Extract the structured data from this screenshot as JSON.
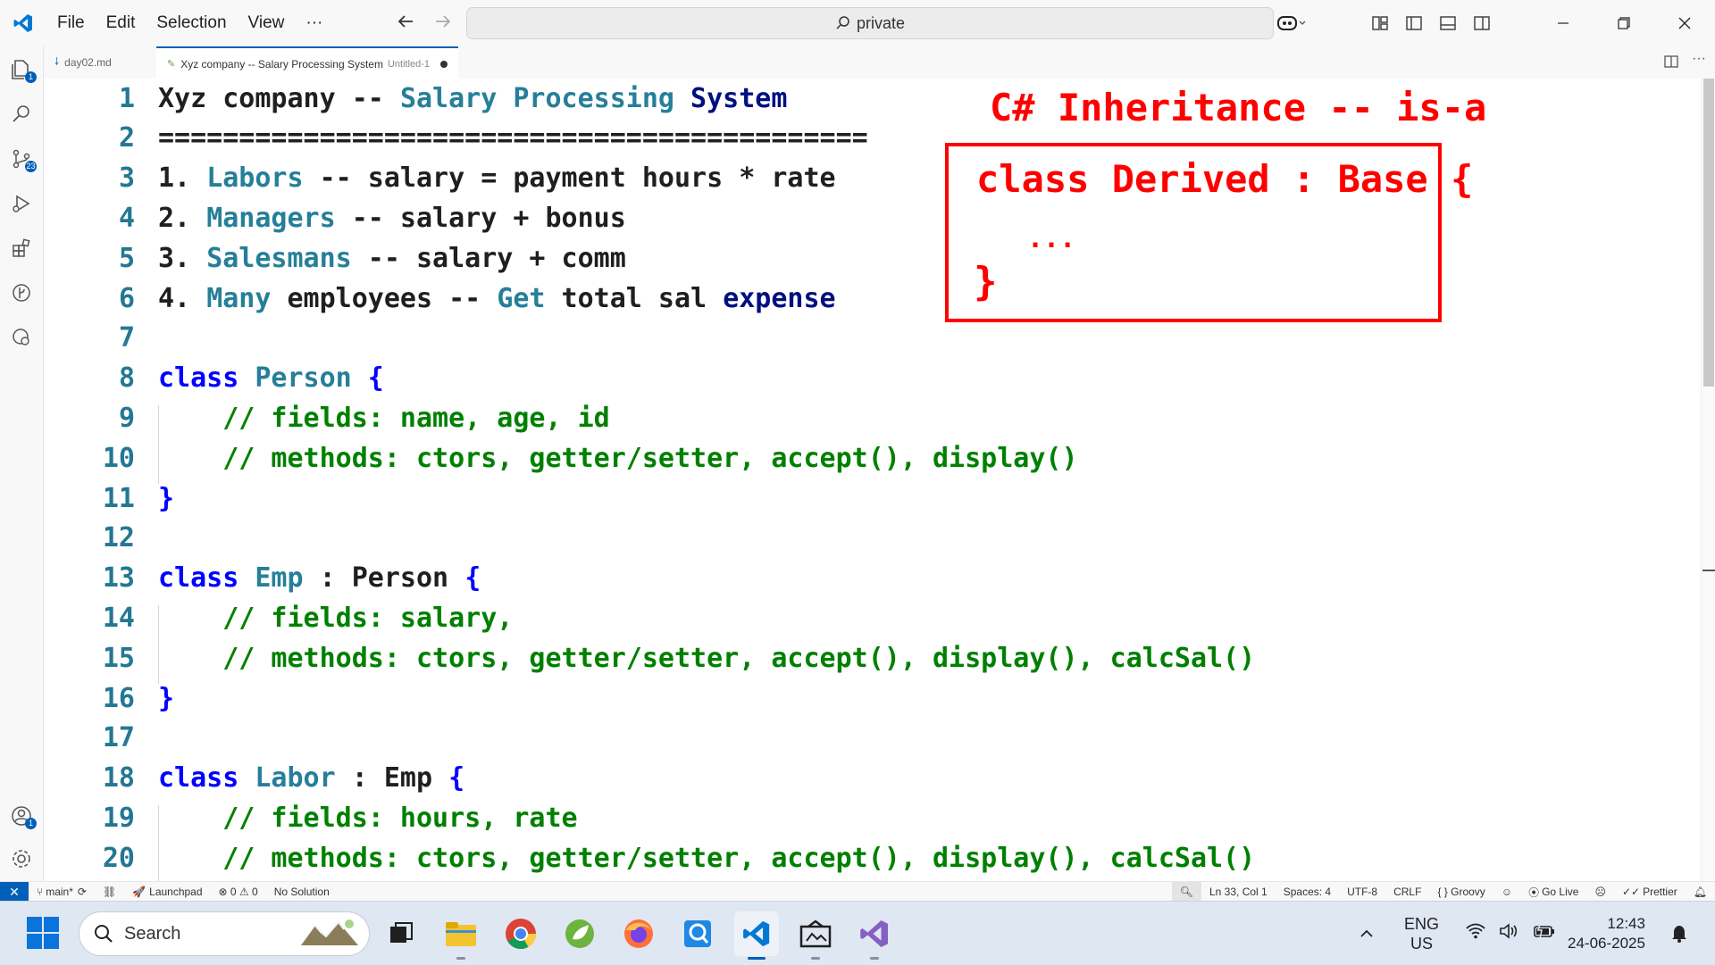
{
  "menubar": {
    "items": [
      "File",
      "Edit",
      "Selection",
      "View",
      "···"
    ]
  },
  "command_center": {
    "text": "private"
  },
  "tabs": [
    {
      "label": "day02.md",
      "active": false
    },
    {
      "label": "Xyz company -- Salary Processing System",
      "sublabel": "Untitled-1",
      "active": true,
      "modified": true
    }
  ],
  "activity_badges": {
    "explorer": "1",
    "scm": "23",
    "accounts": "1"
  },
  "editor": {
    "lines": [
      {
        "n": "1",
        "tokens": [
          [
            "Xyz ",
            "txt"
          ],
          [
            "company ",
            "txt"
          ],
          [
            "-- ",
            "txt"
          ],
          [
            "Salary Processing ",
            "type"
          ],
          [
            "System",
            "navy"
          ]
        ]
      },
      {
        "n": "2",
        "tokens": [
          [
            "============================================",
            "txt"
          ]
        ]
      },
      {
        "n": "3",
        "tokens": [
          [
            "1. ",
            "txt"
          ],
          [
            "Labors",
            "type"
          ],
          [
            " -- salary = payment hours * rate",
            "txt"
          ]
        ]
      },
      {
        "n": "4",
        "tokens": [
          [
            "2. ",
            "txt"
          ],
          [
            "Managers",
            "type"
          ],
          [
            " -- salary + bonus",
            "txt"
          ]
        ]
      },
      {
        "n": "5",
        "tokens": [
          [
            "3. ",
            "txt"
          ],
          [
            "Salesmans",
            "type"
          ],
          [
            " -- salary + comm",
            "txt"
          ]
        ]
      },
      {
        "n": "6",
        "tokens": [
          [
            "4. ",
            "txt"
          ],
          [
            "Many",
            "type"
          ],
          [
            " employees -- ",
            "txt"
          ],
          [
            "Get",
            "type"
          ],
          [
            " total sal ",
            "txt"
          ],
          [
            "expense",
            "navy"
          ]
        ]
      },
      {
        "n": "7",
        "tokens": []
      },
      {
        "n": "8",
        "tokens": [
          [
            "class ",
            "kw"
          ],
          [
            "Person",
            "type"
          ],
          [
            " {",
            "kw"
          ]
        ]
      },
      {
        "n": "9",
        "tokens": [
          [
            "    // fields: name, age, id",
            "cm"
          ]
        ]
      },
      {
        "n": "10",
        "tokens": [
          [
            "    // methods: ctors, getter/setter, accept(), display()",
            "cm"
          ]
        ]
      },
      {
        "n": "11",
        "tokens": [
          [
            "}",
            "kw"
          ]
        ]
      },
      {
        "n": "12",
        "tokens": []
      },
      {
        "n": "13",
        "tokens": [
          [
            "class ",
            "kw"
          ],
          [
            "Emp",
            "type"
          ],
          [
            " : Person ",
            "txt"
          ],
          [
            "{",
            "kw"
          ]
        ]
      },
      {
        "n": "14",
        "tokens": [
          [
            "    // fields: salary,",
            "cm"
          ]
        ]
      },
      {
        "n": "15",
        "tokens": [
          [
            "    // methods: ctors, getter/setter, accept(), display(), calcSal()",
            "cm"
          ]
        ]
      },
      {
        "n": "16",
        "tokens": [
          [
            "}",
            "kw"
          ]
        ]
      },
      {
        "n": "17",
        "tokens": []
      },
      {
        "n": "18",
        "tokens": [
          [
            "class ",
            "kw"
          ],
          [
            "Labor",
            "type"
          ],
          [
            " : Emp ",
            "txt"
          ],
          [
            "{",
            "kw"
          ]
        ]
      },
      {
        "n": "19",
        "tokens": [
          [
            "    // fields: hours, rate",
            "cm"
          ]
        ]
      },
      {
        "n": "20",
        "tokens": [
          [
            "    // methods: ctors, getter/setter, accept(), display(), calcSal()",
            "cm"
          ]
        ]
      }
    ]
  },
  "annotation": {
    "title": "C# Inheritance -- is-a",
    "line1": "class Derived : Base {",
    "line2": "...",
    "line3": "}"
  },
  "statusbar": {
    "branch": "main*",
    "launchpad": "Launchpad",
    "problems": "⊗ 0 ⚠ 0",
    "solution": "No Solution",
    "position": "Ln 33, Col 1",
    "spaces": "Spaces: 4",
    "encoding": "UTF-8",
    "eol": "CRLF",
    "language": "{ } Groovy",
    "golive": "Go Live",
    "prettier": "Prettier"
  },
  "taskbar": {
    "search_placeholder": "Search",
    "lang_top": "ENG",
    "lang_bottom": "US",
    "time": "12:43",
    "date": "24-06-2025"
  },
  "colors": {
    "accent": "#005fb8",
    "annotation_red": "#ff0000",
    "comment_green": "#008000",
    "keyword_blue": "#0000ff",
    "type_teal": "#267f99"
  }
}
